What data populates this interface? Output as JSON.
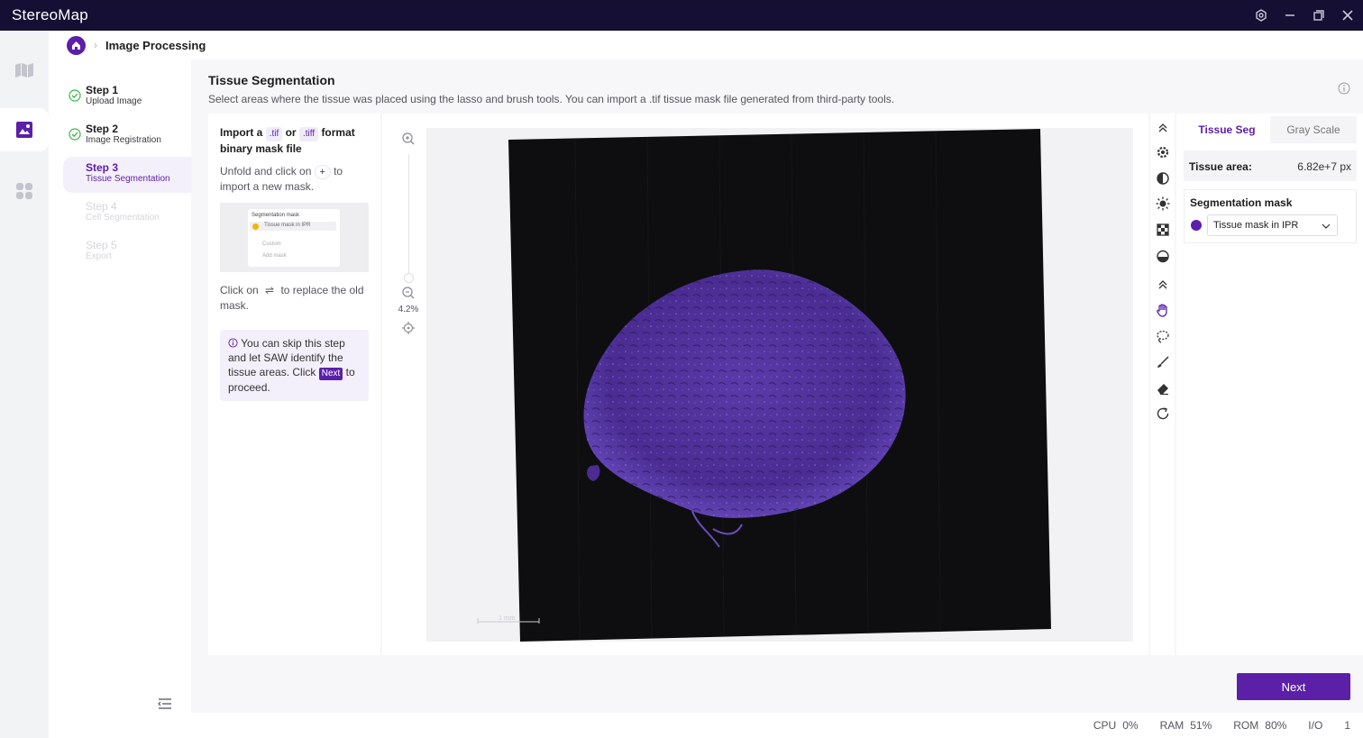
{
  "app": {
    "title": "StereoMap"
  },
  "window_controls": [
    "settings-icon",
    "minimize-icon",
    "restore-icon",
    "close-icon"
  ],
  "rail": {
    "items": [
      "map-icon",
      "image-icon",
      "apps-icon"
    ],
    "active": "image-icon"
  },
  "breadcrumb": {
    "title": "Image Processing"
  },
  "steps": [
    {
      "title": "Step 1",
      "subtitle": "Upload Image",
      "state": "done"
    },
    {
      "title": "Step 2",
      "subtitle": "Image Registration",
      "state": "done"
    },
    {
      "title": "Step 3",
      "subtitle": "Tissue Segmentation",
      "state": "active"
    },
    {
      "title": "Step 4",
      "subtitle": "Cell Segmentation",
      "state": "disabled"
    },
    {
      "title": "Step 5",
      "subtitle": "Export",
      "state": "disabled"
    }
  ],
  "header": {
    "title": "Tissue Segmentation",
    "description": "Select areas where the tissue was placed using the lasso and brush tools. You can import a .tif tissue mask file generated from third-party tools."
  },
  "instructions": {
    "import_prefix": "Import a",
    "tif_tag": ".tif",
    "or_word": "or",
    "tiff_tag": ".tiff",
    "import_suffix": "format binary mask file",
    "unfold_prefix": "Unfold and click on",
    "plus_glyph": "+",
    "unfold_suffix": "to import a new mask.",
    "mini": {
      "title": "Segmentation mask",
      "item": "Tissue mask in IPR",
      "custom": "Custom",
      "add": "Add mask"
    },
    "replace_prefix": "Click on",
    "swap_glyph": "⇌",
    "replace_suffix": "to replace the old mask.",
    "tip_prefix": "You can skip this step and let SAW identify the tissue areas. Click",
    "tip_next": "Next",
    "tip_suffix": "to proceed."
  },
  "viewer": {
    "zoom": "4.2%",
    "scale_bar_label": "1 mm"
  },
  "tools": [
    "collapse-up-icon",
    "settings-cog-icon",
    "contrast-icon",
    "brightness-icon",
    "checker-icon",
    "drop-icon",
    "collapse-up-icon",
    "hand-icon",
    "lasso-icon",
    "brush-icon",
    "eraser-icon",
    "rotate-icon"
  ],
  "right_panel": {
    "tabs": [
      "Tissue Seg",
      "Gray Scale"
    ],
    "active_tab": "Tissue Seg",
    "area_label": "Tissue area:",
    "area_value": "6.82e+7 px",
    "mask_label": "Segmentation mask",
    "mask_value": "Tissue mask in IPR",
    "mask_color": "#5b1fa8"
  },
  "next_button": "Next",
  "status": {
    "cpu_label": "CPU",
    "cpu": "0%",
    "ram_label": "RAM",
    "ram": "51%",
    "rom_label": "ROM",
    "rom": "80%",
    "io_label": "I/O",
    "io": "1"
  },
  "colors": {
    "accent": "#5b1fa8",
    "titlebar": "#140f33",
    "success": "#3bb54a"
  }
}
